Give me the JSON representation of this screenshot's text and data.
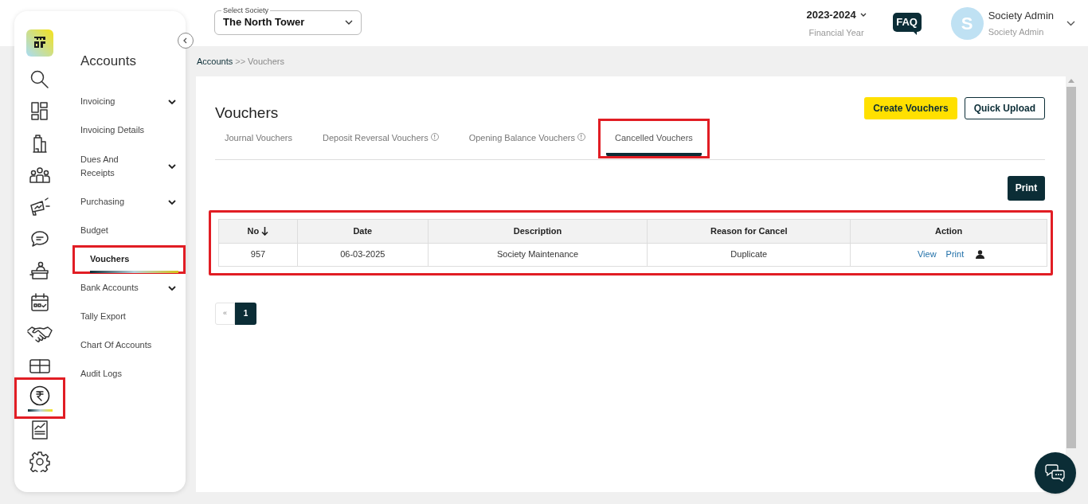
{
  "rail": [
    {
      "selected": false,
      "highlighted": false
    },
    {
      "selected": false,
      "highlighted": false
    },
    {
      "selected": false,
      "highlighted": false
    },
    {
      "selected": false,
      "highlighted": false
    },
    {
      "selected": false,
      "highlighted": false
    },
    {
      "selected": false,
      "highlighted": false
    },
    {
      "selected": false,
      "highlighted": false
    },
    {
      "selected": false,
      "highlighted": false
    },
    {
      "selected": false,
      "highlighted": false
    },
    {
      "selected": false,
      "highlighted": false
    },
    {
      "selected": false,
      "highlighted": false
    },
    {
      "selected": true,
      "highlighted": true
    },
    {
      "selected": false,
      "highlighted": false
    },
    {
      "selected": false,
      "highlighted": false
    }
  ],
  "menu": {
    "title": "Accounts",
    "items": [
      {
        "label": "Invoicing",
        "expandable": true,
        "selected": false,
        "highlighted": false
      },
      {
        "label": "Invoicing Details",
        "expandable": false,
        "selected": false,
        "highlighted": false
      },
      {
        "label": "Dues And Receipts",
        "expandable": true,
        "selected": false,
        "highlighted": false
      },
      {
        "label": "Purchasing",
        "expandable": true,
        "selected": false,
        "highlighted": false
      },
      {
        "label": "Budget",
        "expandable": false,
        "selected": false,
        "highlighted": false
      },
      {
        "label": "Vouchers",
        "expandable": false,
        "selected": true,
        "highlighted": true
      },
      {
        "label": "Bank Accounts",
        "expandable": true,
        "selected": false,
        "highlighted": false
      },
      {
        "label": "Tally Export",
        "expandable": false,
        "selected": false,
        "highlighted": false
      },
      {
        "label": "Chart Of Accounts",
        "expandable": false,
        "selected": false,
        "highlighted": false
      },
      {
        "label": "Audit Logs",
        "expandable": false,
        "selected": false,
        "highlighted": false
      }
    ]
  },
  "header": {
    "society": {
      "label": "Select Society",
      "value": "The North Tower"
    },
    "year": {
      "value": "2023-2024",
      "caption": "Financial Year"
    },
    "faq": "FAQ",
    "user": {
      "initial": "S",
      "name": "Society Admin",
      "role": "Society Admin"
    }
  },
  "breadcrumb": {
    "parent": "Accounts",
    "separator": ">>",
    "current": "Vouchers"
  },
  "page": {
    "title": "Vouchers",
    "buttons": [
      {
        "label": "Create Vouchers",
        "kind": "primary"
      },
      {
        "label": "Quick Upload",
        "kind": "outline"
      }
    ],
    "tabs": [
      {
        "label": "Journal Vouchers",
        "info": false,
        "selected": false,
        "highlighted": false
      },
      {
        "label": "Deposit Reversal Vouchers",
        "info": true,
        "selected": false,
        "highlighted": false
      },
      {
        "label": "Opening Balance Vouchers",
        "info": true,
        "selected": false,
        "highlighted": false
      },
      {
        "label": "Cancelled Vouchers",
        "info": false,
        "selected": true,
        "highlighted": true
      }
    ],
    "print": "Print",
    "table": {
      "highlighted": true,
      "columns": [
        {
          "label": "No",
          "sorted": true
        },
        {
          "label": "Date",
          "sorted": false
        },
        {
          "label": "Description",
          "sorted": false
        },
        {
          "label": "Reason for Cancel",
          "sorted": false
        },
        {
          "label": "Action",
          "sorted": false
        }
      ],
      "rows": [
        {
          "no": "957",
          "date": "06-03-2025",
          "description": "Society Maintenance",
          "reason": "Duplicate",
          "actions": [
            "View",
            "Print"
          ]
        }
      ]
    },
    "pagination": {
      "prev": "«",
      "pages": [
        {
          "label": "1",
          "selected": true
        }
      ]
    }
  }
}
